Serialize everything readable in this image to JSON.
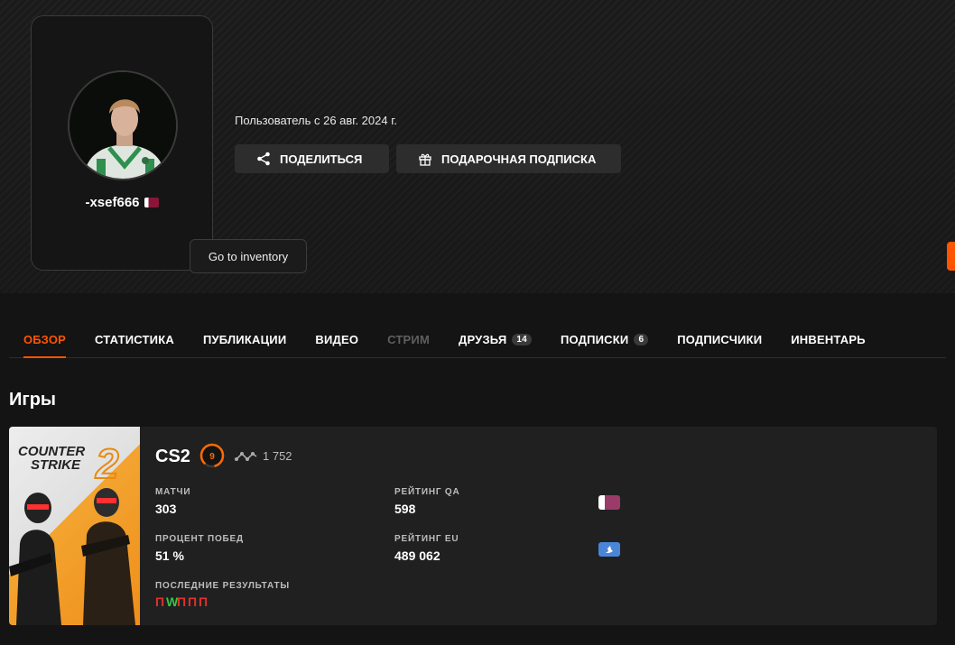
{
  "profile": {
    "username": "-xsef666",
    "member_since": "Пользователь с 26 авг. 2024 г.",
    "tooltip": "Go to inventory"
  },
  "actions": {
    "share_label": "ПОДЕЛИТЬСЯ",
    "gift_label": "ПОДАРОЧНАЯ ПОДПИСКА"
  },
  "tabs": [
    {
      "label": "ОБЗОР",
      "state": "active"
    },
    {
      "label": "СТАТИСТИКА"
    },
    {
      "label": "ПУБЛИКАЦИИ"
    },
    {
      "label": "ВИДЕО"
    },
    {
      "label": "СТРИМ",
      "state": "disabled"
    },
    {
      "label": "ДРУЗЬЯ",
      "badge": "14"
    },
    {
      "label": "ПОДПИСКИ",
      "badge": "6"
    },
    {
      "label": "ПОДПИСЧИКИ"
    },
    {
      "label": "ИНВЕНТАРЬ"
    }
  ],
  "games_section": {
    "title": "Игры"
  },
  "game": {
    "name": "CS2",
    "cover_line1": "COUNTER",
    "cover_line2": "STRIKE",
    "cover_number": "2",
    "level": "9",
    "level_fraction": 0.85,
    "elo": "1 752",
    "matches_label": "МАТЧИ",
    "matches_value": "303",
    "winrate_label": "ПРОЦЕНТ ПОБЕД",
    "winrate_value": "51 %",
    "rating_qa_label": "РЕЙТИНГ QA",
    "rating_qa_value": "598",
    "rating_eu_label": "РЕЙТИНГ EU",
    "rating_eu_value": "489 062",
    "recent_label": "ПОСЛЕДНИЕ РЕЗУЛЬТАТЫ",
    "recent_results": [
      "П",
      "W",
      "П",
      "П",
      "П"
    ]
  },
  "colors": {
    "accent": "#ff5500",
    "win": "#32c846",
    "loss": "#e0322d",
    "eu_flag": "#4a86d8",
    "qa_flag": "#9a3c6a"
  }
}
